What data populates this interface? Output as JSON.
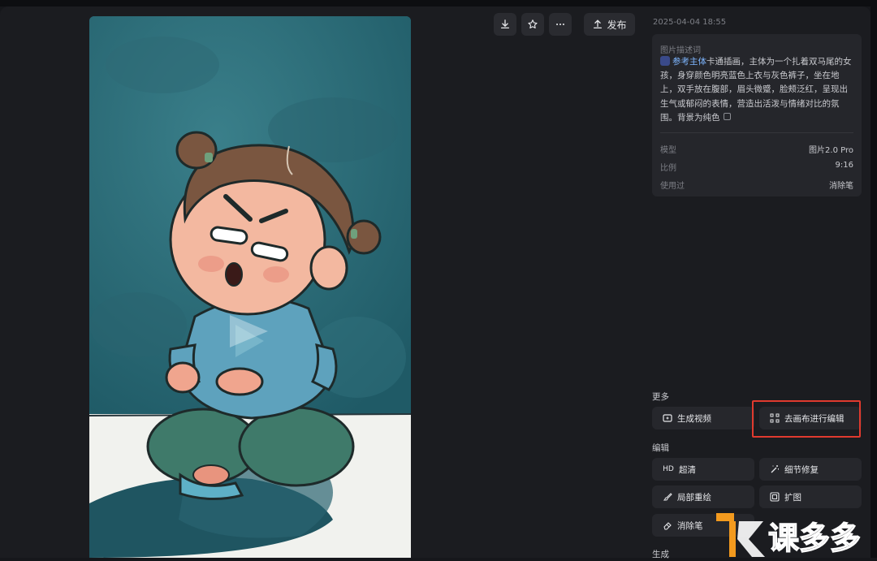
{
  "toolbar": {
    "download_icon": "download-icon",
    "favorite_icon": "star-icon",
    "more_icon": "more-icon",
    "publish_label": "发布"
  },
  "image_info": {
    "timestamp": "2025-04-04 18:55",
    "description_title": "图片描述词",
    "reference_chip": "参考主体",
    "prompt_text": "卡通插画，主体为一个扎着双马尾的女孩，身穿颜色明亮蓝色上衣与灰色裤子，坐在地上，双手放在腹部，眉头微蹙，脸颊泛红，呈现出生气或郁闷的表情，营造出活泼与情绪对比的氛围。背景为纯色",
    "meta": [
      {
        "key": "模型",
        "value": "图片2.0 Pro"
      },
      {
        "key": "比例",
        "value": "9:16"
      },
      {
        "key": "使用过",
        "value": "消除笔"
      }
    ]
  },
  "sections": {
    "more_label": "更多",
    "more_buttons": [
      {
        "label": "生成视频",
        "icon": "video-generate-icon"
      },
      {
        "label": "去画布进行编辑",
        "icon": "canvas-edit-icon"
      }
    ],
    "edit_label": "编辑",
    "edit_buttons": [
      {
        "label": "超清",
        "icon": "hd-icon",
        "icon_text": "HD"
      },
      {
        "label": "细节修复",
        "icon": "magic-wand-icon"
      },
      {
        "label": "局部重绘",
        "icon": "brush-icon"
      },
      {
        "label": "扩图",
        "icon": "expand-icon"
      },
      {
        "label": "消除笔",
        "icon": "eraser-icon"
      }
    ],
    "generate_label": "生成"
  },
  "colors": {
    "background": "#1b1c20",
    "card": "#25262b",
    "button": "#26272c",
    "highlight": "#e03a2e",
    "accent_link": "#7eb6ff",
    "watermark_orange": "#f39a1e"
  },
  "watermark": {
    "text": "课多多"
  }
}
